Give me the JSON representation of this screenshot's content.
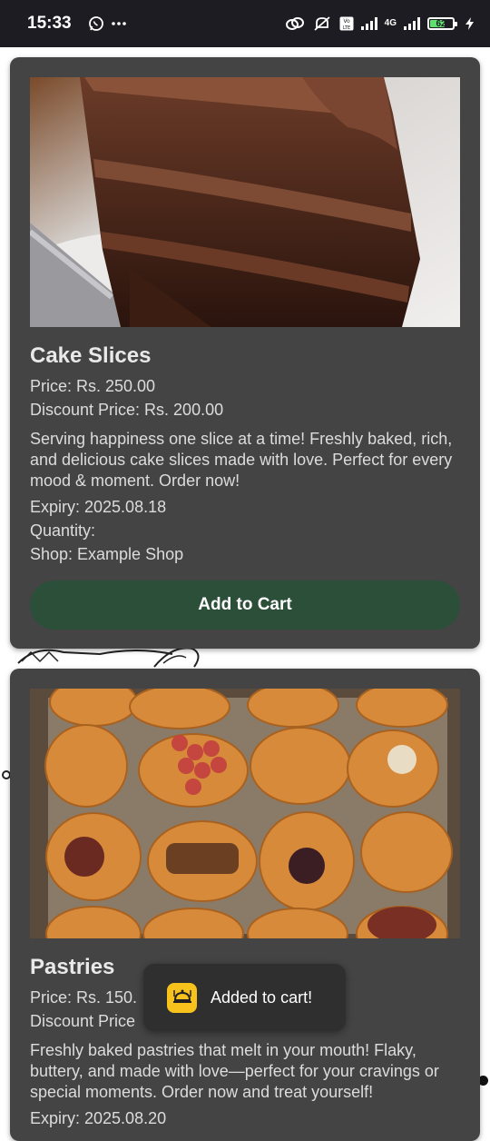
{
  "status_bar": {
    "time": "15:33",
    "network_label": "4G",
    "volte_label": "Vo LTE",
    "battery_level": "62",
    "icons": [
      "whatsapp-icon",
      "more-dots-icon",
      "link-icon",
      "mute-icon",
      "volte-icon",
      "signal-icon",
      "signal-4g-icon",
      "battery-icon",
      "charging-icon"
    ]
  },
  "products": [
    {
      "name": "Cake Slices",
      "price": "Price: Rs. 250.00",
      "discount_price": "Discount Price: Rs. 200.00",
      "description": "Serving happiness one slice at a time! Freshly baked, rich, and delicious cake slices made with love. Perfect for every mood & moment. Order now!",
      "expiry": "Expiry: 2025.08.18",
      "quantity": "Quantity:",
      "shop": "Shop: Example Shop",
      "button_label": "Add to Cart",
      "image": "chocolate-cake-slice-image"
    },
    {
      "name": "Pastries",
      "price": "Price: Rs. 150.",
      "discount_price": "Discount Price",
      "description": "Freshly baked pastries that melt in your mouth! Flaky, buttery, and made with love—perfect for your cravings or special moments. Order now and treat yourself!",
      "expiry": "Expiry: 2025.08.20",
      "image": "assorted-pastries-image"
    }
  ],
  "toast": {
    "text": "Added to cart!",
    "icon": "dish-icon"
  },
  "colors": {
    "status_bar_bg": "#1d1c22",
    "card_bg": "#444444",
    "button_bg": "#2c4f3a",
    "toast_bg": "#2f2f2f",
    "toast_icon_bg": "#f7c21b",
    "battery_fill": "#5ee16e"
  }
}
